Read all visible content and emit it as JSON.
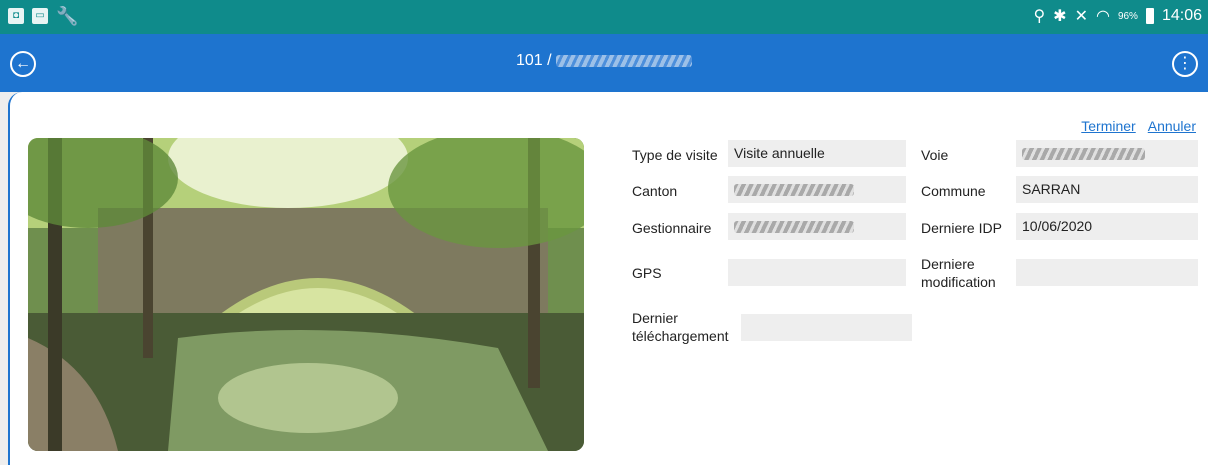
{
  "status_bar": {
    "left_icons": [
      "sms-icon",
      "message-icon",
      "wrench-icon"
    ],
    "right_icons": [
      "location-icon",
      "bluetooth-icon",
      "mute-icon",
      "wifi-icon"
    ],
    "battery": "96%",
    "time": "14:06"
  },
  "app_bar": {
    "title_number": "101 /",
    "title_name_redacted": "████████"
  },
  "actions": {
    "finish": "Terminer",
    "cancel": "Annuler"
  },
  "fields": {
    "type_visite": {
      "label": "Type de visite",
      "value": "Visite annuelle"
    },
    "canton": {
      "label": "Canton",
      "value": "████████"
    },
    "gestionnaire": {
      "label": "Gestionnaire",
      "value": "████████"
    },
    "gps": {
      "label": "GPS",
      "value": ""
    },
    "dernier_telechargement": {
      "label": "Dernier\ntéléchargement",
      "value": ""
    },
    "voie": {
      "label": "Voie",
      "value": "████████"
    },
    "commune": {
      "label": "Commune",
      "value": "SARRAN"
    },
    "derniere_idp": {
      "label": "Derniere IDP",
      "value": "10/06/2020"
    },
    "derniere_modification": {
      "label": "Derniere\nmodification",
      "value": ""
    }
  },
  "colors": {
    "status_bar": "#0f8b8b",
    "app_bar": "#1e74cf",
    "link": "#1e74cf",
    "field_bg": "#eeeeee"
  }
}
